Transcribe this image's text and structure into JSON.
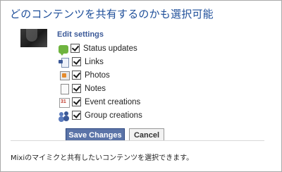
{
  "headline": "どのコンテンツを共有するのかも選択可能",
  "panel": {
    "section_title": "Edit settings",
    "items": [
      {
        "label": "Status updates",
        "checked": true,
        "icon": "status-icon"
      },
      {
        "label": "Links",
        "checked": true,
        "icon": "link-icon"
      },
      {
        "label": "Photos",
        "checked": true,
        "icon": "photo-icon"
      },
      {
        "label": "Notes",
        "checked": true,
        "icon": "notes-icon"
      },
      {
        "label": "Event creations",
        "checked": true,
        "icon": "calendar-icon"
      },
      {
        "label": "Group creations",
        "checked": true,
        "icon": "group-icon"
      }
    ],
    "save_label": "Save Changes",
    "cancel_label": "Cancel"
  },
  "caption": "Mixiのマイミクと共有したいコンテンツを選択できます。",
  "colors": {
    "headline": "#1f4f9a",
    "facebook_blue": "#3b5998",
    "save_button": "#5b74a8",
    "border": "#a9a9a9"
  }
}
